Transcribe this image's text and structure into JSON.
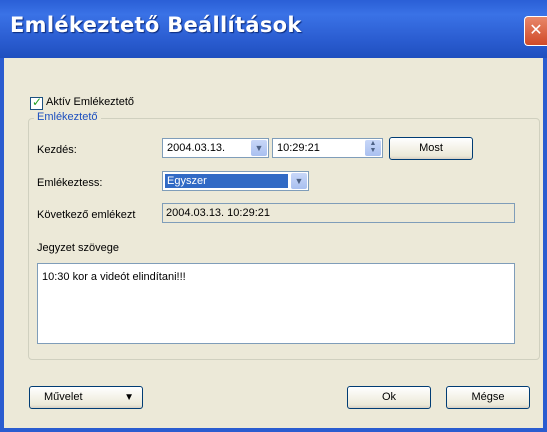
{
  "window": {
    "title": "Emlékeztető Beállítások",
    "close": "✕"
  },
  "active_checkbox": {
    "label": "Aktív Emlékeztető",
    "checked": true
  },
  "group": {
    "legend": "Emlékeztető",
    "start": {
      "label": "Kezdés:",
      "date": "2004.03.13.",
      "time": "10:29:21",
      "now_button": "Most"
    },
    "remind": {
      "label": "Emlékeztess:",
      "value": "Egyszer"
    },
    "next": {
      "label": "Következő emlékezt",
      "value": "2004.03.13. 10:29:21"
    },
    "note": {
      "label": "Jegyzet szövege",
      "text": "10:30 kor a videót elindítani!!!"
    }
  },
  "footer": {
    "action_button": "Művelet",
    "ok_button": "Ok",
    "cancel_button": "Mégse"
  },
  "icons": {
    "dropdown": "chevron-down-icon",
    "spinner": "spin-updown-icon",
    "check": "checkmark-icon"
  },
  "colors": {
    "titlebar": "#2a5cd0",
    "selection": "#316ac5",
    "legend": "#1c4fbf"
  }
}
